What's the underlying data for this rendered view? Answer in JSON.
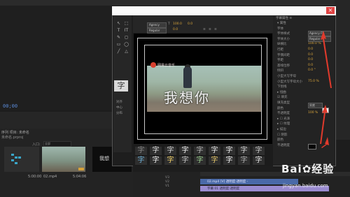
{
  "dialog": {
    "close_label": "×"
  },
  "background": {
    "left_timecode": "00;00",
    "project_tabs": "序列 项目: 未命名",
    "project_file": "未命名.prproj",
    "input_label": "入口:",
    "input_value": "全部",
    "clips": [
      {
        "name": "",
        "duration": "5:00:00"
      },
      {
        "name": "02.mp4",
        "duration": "5:04:06"
      }
    ],
    "clip3_text": "我想",
    "track_labels": [
      "V3",
      "V2",
      "V1"
    ],
    "timeline_clips": [
      "02.mp4 [V] 透明度:透明度 -",
      "字幕 01 透明度:透明度"
    ]
  },
  "tools": {
    "items": [
      "↖",
      "⬚",
      "T",
      "IT",
      "✎",
      "◻",
      "▭",
      "◯",
      "╱",
      "△"
    ],
    "active": "T",
    "labels": [
      "对齐",
      "中心",
      "分布"
    ]
  },
  "top_options": {
    "font": "Agency",
    "style": "Regular",
    "size": "100.0",
    "kerning": "0.0",
    "leading": "0.0",
    "tab_label": "T",
    "align_labels": [
      "≡",
      "≡",
      "≡"
    ]
  },
  "canvas": {
    "logo_text": "网易云音乐",
    "subtitle": "我想你"
  },
  "styles": {
    "glyph": "字",
    "colors": [
      "#8a8a8a",
      "#e0e0e0",
      "#d4d4d4",
      "#f5f5f5",
      "#b8b8b8",
      "#e9e9e9",
      "#efefef",
      "#d7d7d7",
      "#c9c9c9",
      "#6fb0d6",
      "#f2f2f2",
      "#f2d16a",
      "#c8c8c8",
      "#9cd08f",
      "#e6c76a",
      "#f7f7f7",
      "#b0b0b0",
      "#e6e6e6"
    ]
  },
  "props": {
    "title": "字幕属性 ≡",
    "rows": [
      {
        "label": "▾ 属性",
        "value": ""
      },
      {
        "label": "字体",
        "value": ""
      },
      {
        "label": "字体样式",
        "value": ""
      },
      {
        "label": "字体大小",
        "value": "100.0"
      },
      {
        "label": "纵横比",
        "value": "100.0 %"
      },
      {
        "label": "行距",
        "value": "0.0"
      },
      {
        "label": "字偶间距",
        "value": "0.0"
      },
      {
        "label": "字距",
        "value": "0.0"
      },
      {
        "label": "基线位移",
        "value": "0.0"
      },
      {
        "label": "倾斜",
        "value": "0.0 °"
      },
      {
        "label": "小型大写字母",
        "value": ""
      },
      {
        "label": "小型大写字母大小",
        "value": "75.0 %"
      },
      {
        "label": "下划线",
        "value": ""
      },
      {
        "label": "▸ 扭曲",
        "value": ""
      },
      {
        "label": "☑ 填充",
        "value": ""
      },
      {
        "label": "填充类型",
        "value": ""
      },
      {
        "label": "颜色",
        "value": ""
      },
      {
        "label": "不透明度",
        "value": "100 %"
      },
      {
        "label": "▸ ☐ 光泽",
        "value": ""
      },
      {
        "label": "▸ ☐ 纹理",
        "value": ""
      },
      {
        "label": "▸ 描边",
        "value": ""
      },
      {
        "label": "☐ 阴影",
        "value": ""
      },
      {
        "label": "颜色",
        "value": ""
      },
      {
        "label": "不透明度",
        "value": ""
      }
    ],
    "font_value": "Agency FB",
    "style_value": "Regular",
    "fill_type": "实底",
    "fill_color": "#f2f2f2",
    "shadow_color": "#050505",
    "arrow_color": "#e03a2c"
  },
  "watermark": {
    "text": "Bai✿经验",
    "sub": "jingyan.baidu.com"
  }
}
